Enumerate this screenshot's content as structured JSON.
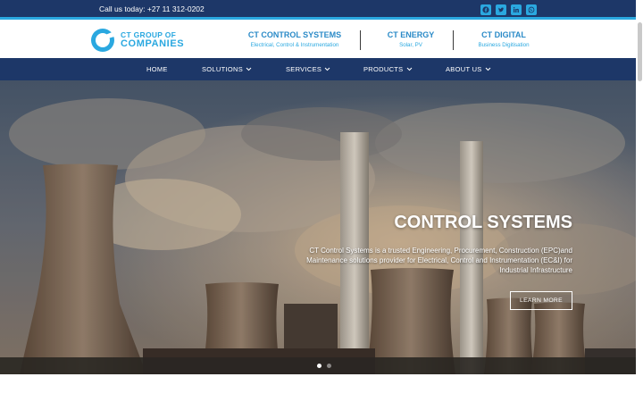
{
  "topbar": {
    "phone": "Call us today: +27 11 312-0202",
    "social": [
      "facebook-icon",
      "twitter-icon",
      "linkedin-icon",
      "whatsapp-icon"
    ]
  },
  "header": {
    "logo_line1": "CT GROUP OF",
    "logo_line2": "COMPANIES",
    "companies": [
      {
        "name": "CT CONTROL SYSTEMS",
        "sub": "Electrical, Control & Instrumentation"
      },
      {
        "name": "CT ENERGY",
        "sub": "Solar, PV"
      },
      {
        "name": "CT DIGITAL",
        "sub": "Business Digitisation"
      }
    ]
  },
  "nav": {
    "items": [
      {
        "label": "HOME",
        "dropdown": false
      },
      {
        "label": "SOLUTIONS",
        "dropdown": true
      },
      {
        "label": "SERVICES",
        "dropdown": true
      },
      {
        "label": "PRODUCTS",
        "dropdown": true
      },
      {
        "label": "ABOUT US",
        "dropdown": true
      }
    ]
  },
  "hero": {
    "title": "CONTROL SYSTEMS",
    "description": "CT Control Systems is a trusted Engineering, Procurement, Construction (EPC)and Maintenance solutions provider for Electrical, Control and Instrumentation (EC&I) for Industrial Infrastructure",
    "button": "LEARN MORE",
    "slides": 2,
    "active_slide": 1
  },
  "colors": {
    "brand_navy": "#1d3768",
    "brand_cyan": "#2aa8e0"
  }
}
